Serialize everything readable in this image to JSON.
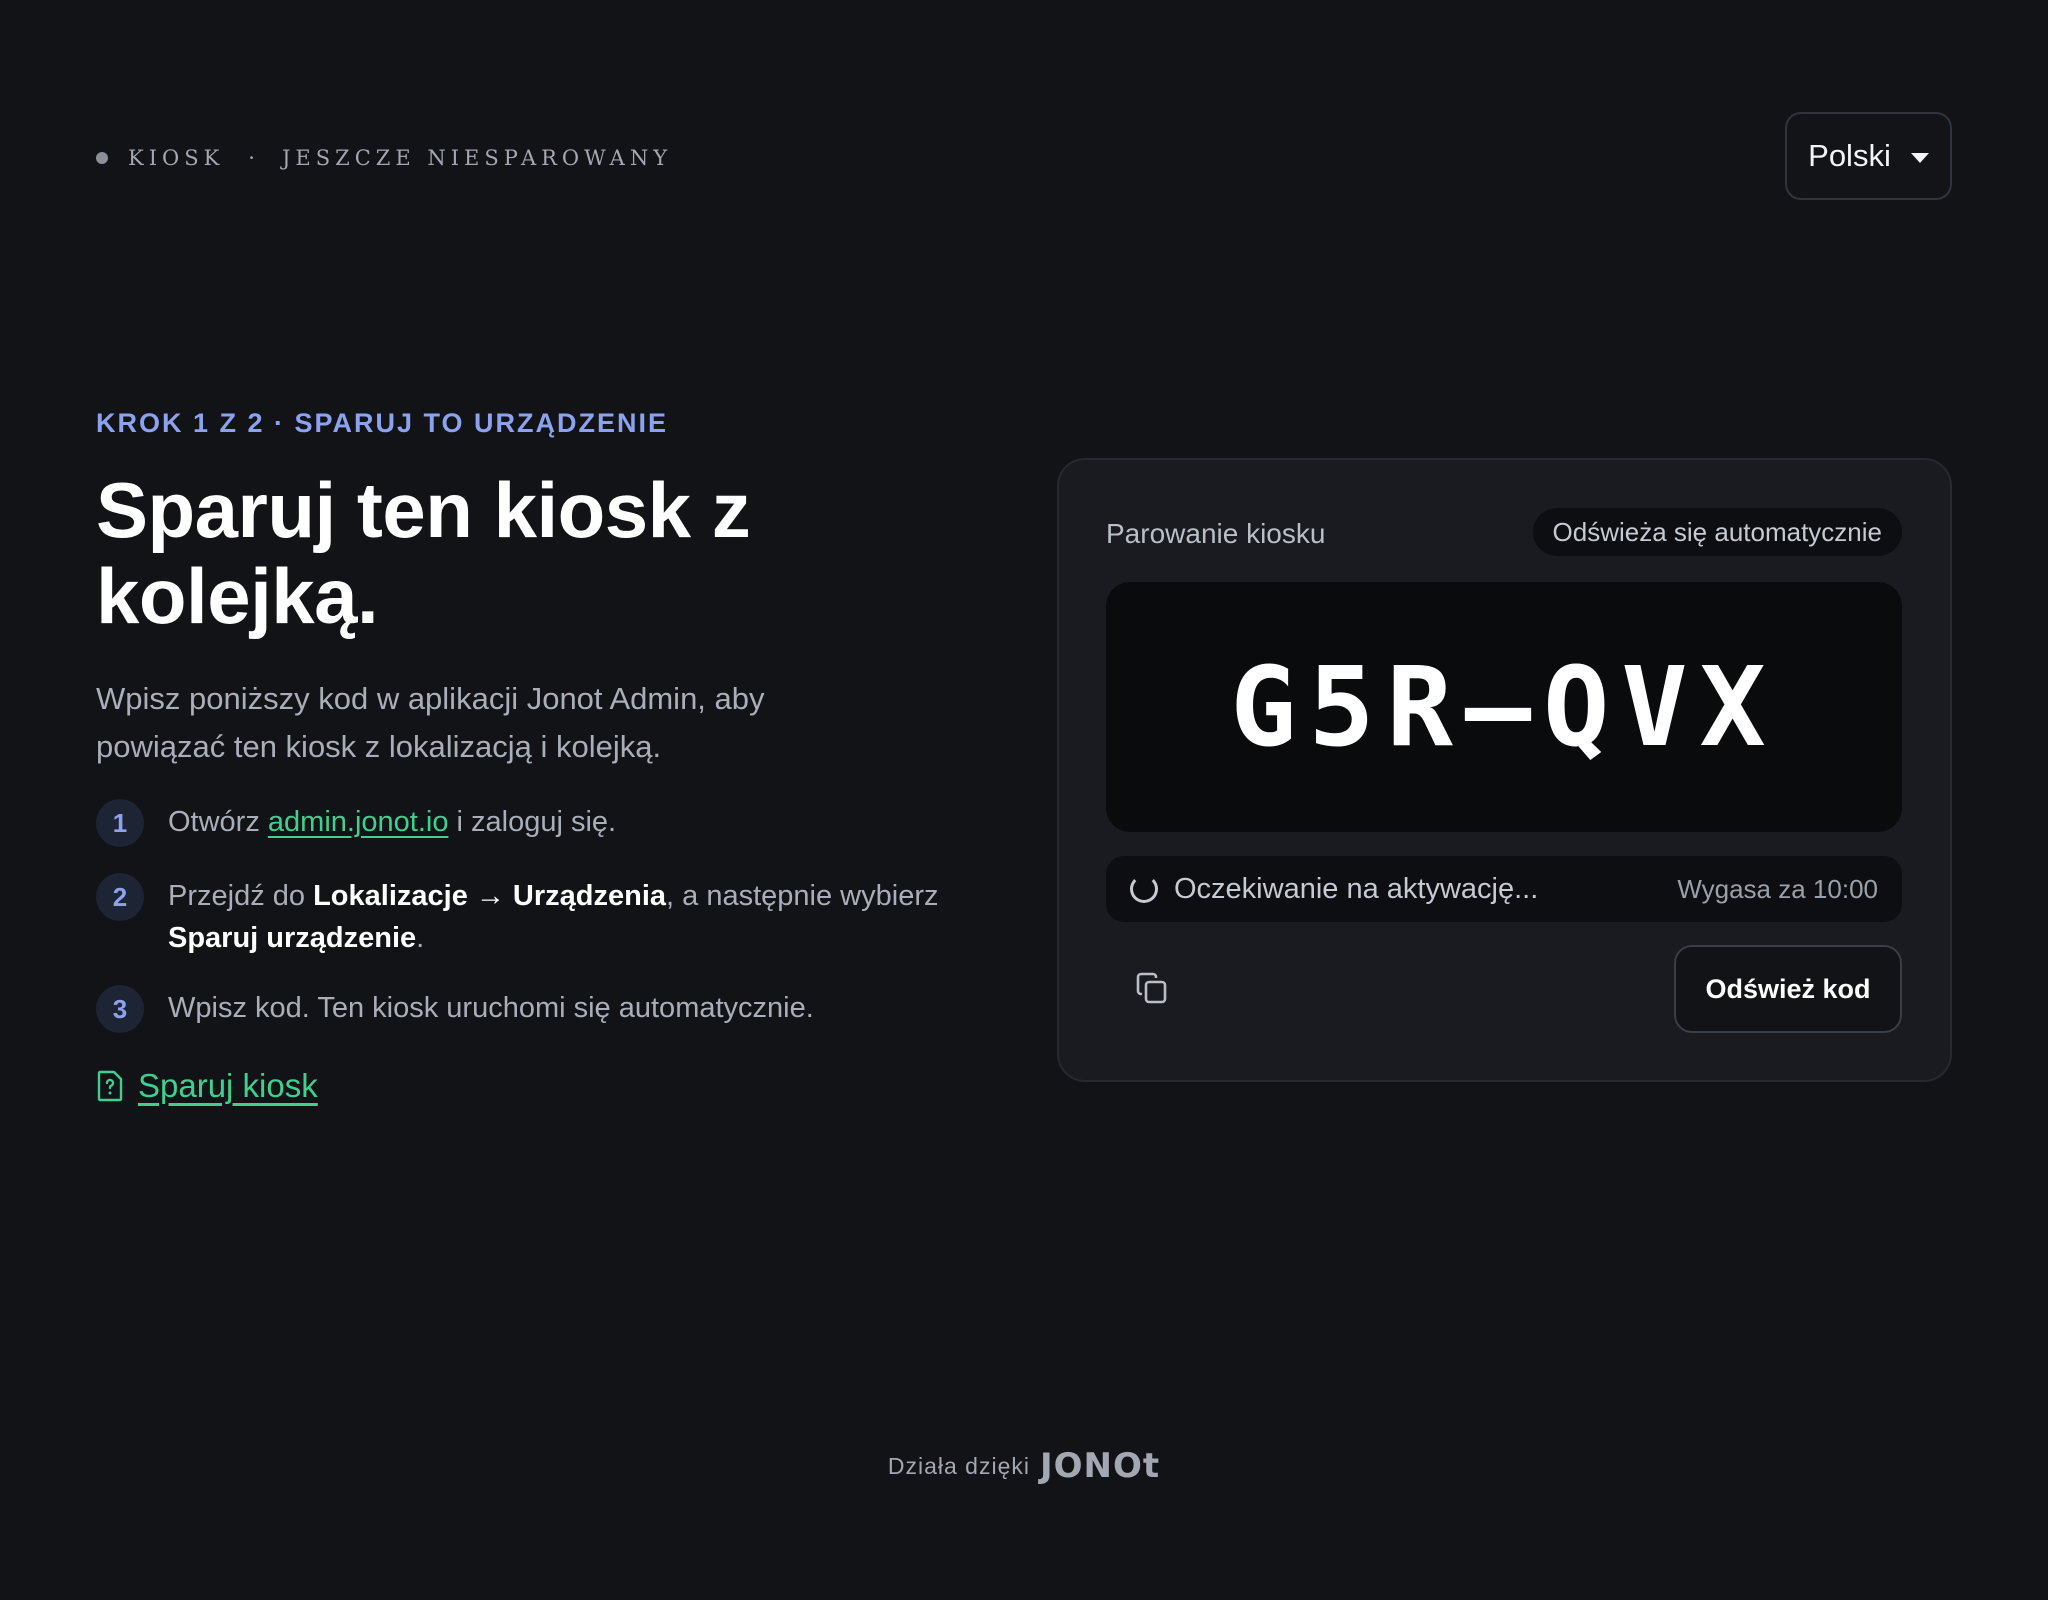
{
  "header": {
    "kiosk_label": "KIOSK",
    "separator": "·",
    "pair_status": "JESZCZE NIESPAROWANY",
    "language": "Polski"
  },
  "intro": {
    "eyebrow": "KROK 1 Z 2 · SPARUJ TO URZĄDZENIE",
    "title": "Sparuj ten kiosk z kolejką.",
    "lead": "Wpisz poniższy kod w aplikacji Jonot Admin, aby powiązać ten kiosk z lokalizacją i kolejką."
  },
  "steps": [
    {
      "number": "1",
      "pre": "Otwórz ",
      "link": "admin.jonot.io",
      "post": " i zaloguj się."
    },
    {
      "number": "2",
      "pre": "Przejdź do ",
      "bold1": "Lokalizacje → Urządzenia",
      "mid": ", a następnie wybierz ",
      "bold2": "Sparuj urządzenie",
      "post": "."
    },
    {
      "number": "3",
      "text": "Wpisz kod. Ten kiosk uruchomi się automatycznie."
    }
  ],
  "help_link": "Sparuj kiosk",
  "card": {
    "label": "Parowanie kiosku",
    "badge": "Odświeża się automatycznie",
    "code": "G5R–QVX",
    "waiting": "Oczekiwanie na aktywację...",
    "expiry": "Wygasa za 10:00",
    "refresh_button": "Odśwież kod"
  },
  "footer": {
    "powered_by": "Działa dzięki",
    "brand": "JONOt"
  },
  "colors": {
    "background": "#111317",
    "accent_blue": "#8da2ee",
    "accent_green": "#3fcf8e",
    "card": "#191b20"
  }
}
